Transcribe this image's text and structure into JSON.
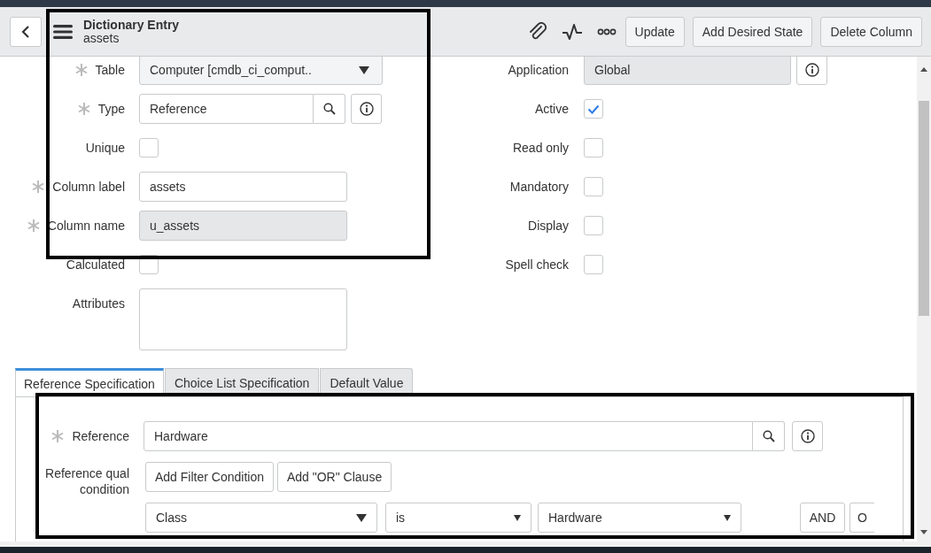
{
  "header": {
    "title": "Dictionary Entry",
    "subtitle": "assets",
    "buttons": [
      "Update",
      "Add Desired State",
      "Delete Column"
    ]
  },
  "form": {
    "left": [
      {
        "kind": "select",
        "label": "Table",
        "required": true,
        "value": "Computer [cmdb_ci_comput..",
        "readonly": true
      },
      {
        "kind": "reference",
        "label": "Type",
        "required": true,
        "value": "Reference",
        "info": true
      },
      {
        "kind": "checkbox",
        "label": "Unique",
        "required": false,
        "checked": false
      },
      {
        "kind": "text",
        "label": "Column label",
        "required": true,
        "value": "assets",
        "readonly": false
      },
      {
        "kind": "text",
        "label": "Column name",
        "required": true,
        "value": "u_assets",
        "readonly": true
      },
      {
        "kind": "checkbox",
        "label": "Calculated",
        "required": false,
        "checked": false
      },
      {
        "kind": "textarea",
        "label": "Attributes",
        "required": false
      }
    ],
    "right": [
      {
        "kind": "text",
        "label": "Application",
        "required": false,
        "value": "Global",
        "readonly": true,
        "info": true
      },
      {
        "kind": "checkbox",
        "label": "Active",
        "required": false,
        "checked": true
      },
      {
        "kind": "checkbox",
        "label": "Read only",
        "required": false,
        "checked": false
      },
      {
        "kind": "checkbox",
        "label": "Mandatory",
        "required": false,
        "checked": false
      },
      {
        "kind": "checkbox",
        "label": "Display",
        "required": false,
        "checked": false
      },
      {
        "kind": "checkbox",
        "label": "Spell check",
        "required": false,
        "checked": false
      }
    ]
  },
  "tabs": [
    {
      "label": "Reference Specification",
      "selected": true
    },
    {
      "label": "Choice List Specification",
      "selected": false
    },
    {
      "label": "Default Value",
      "selected": false
    }
  ],
  "reference": {
    "label": "Reference",
    "required": true,
    "value": "Hardware",
    "info": true
  },
  "qual_condition": {
    "label": "Reference qual condition",
    "buttons": [
      "Add Filter Condition",
      "Add \"OR\" Clause"
    ],
    "condition": {
      "field": "Class",
      "operator": "is",
      "value": "Hardware",
      "buttons": [
        "AND",
        "O"
      ]
    }
  },
  "annotations": [
    {
      "kind": "rectangle"
    },
    {
      "kind": "rectangle"
    }
  ]
}
